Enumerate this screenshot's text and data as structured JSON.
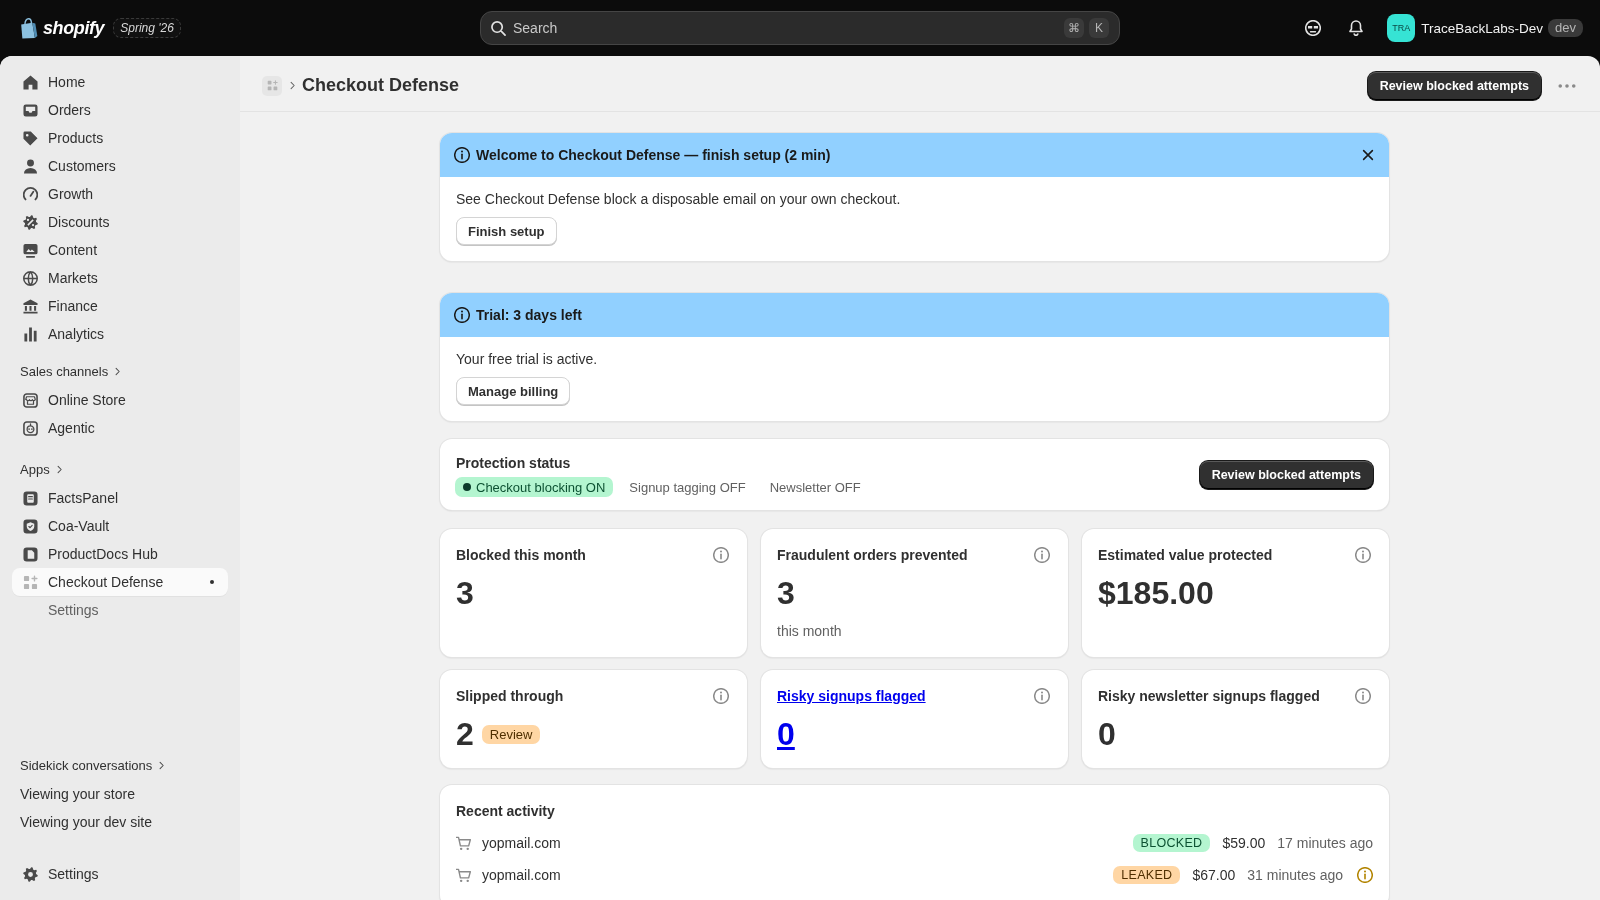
{
  "top_bar": {
    "logo": "shopify",
    "edition": "Spring '26",
    "search": {
      "placeholder": "Search",
      "shortcut": [
        "⌘",
        "K"
      ]
    },
    "store": {
      "initials": "TRA",
      "name": "TraceBackLabs-Dev",
      "badge": "dev"
    }
  },
  "sidebar": {
    "items": [
      {
        "label": "Home",
        "selected": false
      },
      {
        "label": "Orders",
        "selected": false
      },
      {
        "label": "Products",
        "selected": false
      },
      {
        "label": "Customers",
        "selected": false
      },
      {
        "label": "Growth",
        "selected": false
      },
      {
        "label": "Discounts",
        "selected": false
      },
      {
        "label": "Content",
        "selected": false
      },
      {
        "label": "Markets",
        "selected": false
      },
      {
        "label": "Finance",
        "selected": false
      },
      {
        "label": "Analytics",
        "selected": false
      }
    ],
    "sections": [
      {
        "title": "Sales channels",
        "items": [
          {
            "label": "Online Store",
            "selected": false
          },
          {
            "label": "Agentic",
            "selected": false
          }
        ]
      },
      {
        "title": "Apps",
        "items": [
          {
            "label": "FactsPanel",
            "selected": false
          },
          {
            "label": "Coa-Vault",
            "selected": false
          },
          {
            "label": "ProductDocs Hub",
            "selected": false
          },
          {
            "label": "Checkout Defense",
            "selected": true,
            "children": [
              {
                "label": "Settings",
                "selected": false
              }
            ]
          }
        ]
      }
    ],
    "sidekick": {
      "title": "Sidekick conversations",
      "items": [
        {
          "label": "Viewing your store",
          "selected": false
        },
        {
          "label": "Viewing your dev site",
          "selected": false
        }
      ]
    },
    "settings": {
      "label": "Settings",
      "selected": false
    }
  },
  "page": {
    "title": "Checkout Defense",
    "primary_action": "Review blocked attempts"
  },
  "banners": [
    {
      "title": "Welcome to Checkout Defense — finish setup (2 min)",
      "body": "See Checkout Defense block a disposable email on your own checkout.",
      "button": "Finish setup",
      "dismissible": true
    },
    {
      "title": "Trial: 3 days left",
      "body": "Your free trial is active.",
      "button": "Manage billing",
      "dismissible": false
    }
  ],
  "protection": {
    "title": "Protection status",
    "statuses": [
      {
        "label": "Checkout blocking ON",
        "on": true
      },
      {
        "label": "Signup tagging OFF",
        "on": false
      },
      {
        "label": "Newsletter OFF",
        "on": false
      }
    ],
    "button": "Review blocked attempts"
  },
  "stats": [
    {
      "title": "Blocked this month",
      "value": "3",
      "link": false
    },
    {
      "title": "Fraudulent orders prevented",
      "value": "3",
      "note": "this month",
      "link": false
    },
    {
      "title": "Estimated value protected",
      "value": "$185.00",
      "link": false
    },
    {
      "title": "Slipped through",
      "value": "2",
      "badge": "Review",
      "link": false
    },
    {
      "title": "Risky signups flagged",
      "value": "0",
      "link": true
    },
    {
      "title": "Risky newsletter signups flagged",
      "value": "0",
      "link": false
    }
  ],
  "recent_activity": {
    "title": "Recent activity",
    "rows": [
      {
        "domain": "yopmail.com",
        "status": "BLOCKED",
        "kind": "blocked",
        "amount": "$59.00",
        "time": "17 minutes ago",
        "flagged": false
      },
      {
        "domain": "yopmail.com",
        "status": "LEAKED",
        "kind": "leaked",
        "amount": "$67.00",
        "time": "31 minutes ago",
        "flagged": true
      }
    ]
  }
}
